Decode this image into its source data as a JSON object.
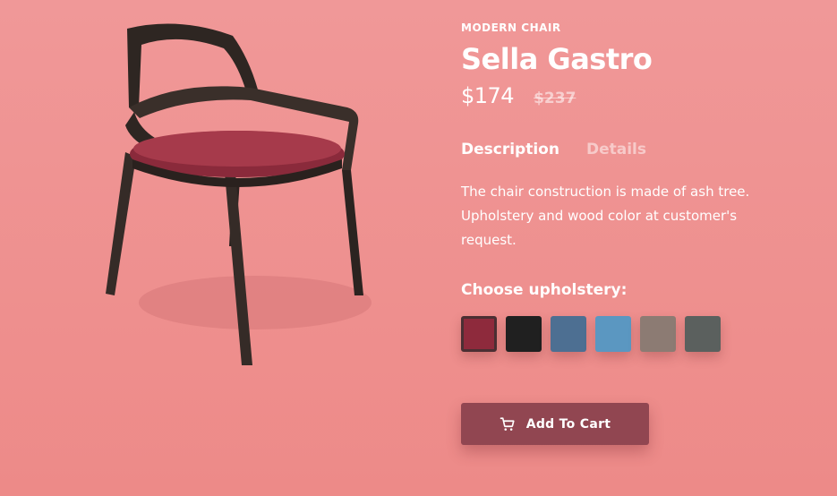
{
  "product": {
    "category": "MODERN CHAIR",
    "name": "Sella Gastro",
    "price": "$174",
    "old_price": "$237"
  },
  "tabs": [
    {
      "label": "Description",
      "active": true
    },
    {
      "label": "Details",
      "active": false
    }
  ],
  "description": "The chair construction is made of ash tree. Upholstery and wood color at customer's request.",
  "upholstery": {
    "label": "Choose upholstery:",
    "swatches": [
      {
        "color": "#8e2a3c",
        "selected": true
      },
      {
        "color": "#202020",
        "selected": false
      },
      {
        "color": "#4d6f92",
        "selected": false
      },
      {
        "color": "#5b97c1",
        "selected": false
      },
      {
        "color": "#8c7b73",
        "selected": false
      },
      {
        "color": "#5b605e",
        "selected": false
      }
    ]
  },
  "cart_button": {
    "label": "Add To Cart",
    "icon": "cart-icon",
    "color": "#914651"
  },
  "colors": {
    "background": "#ef9090",
    "text": "#ffffff"
  }
}
